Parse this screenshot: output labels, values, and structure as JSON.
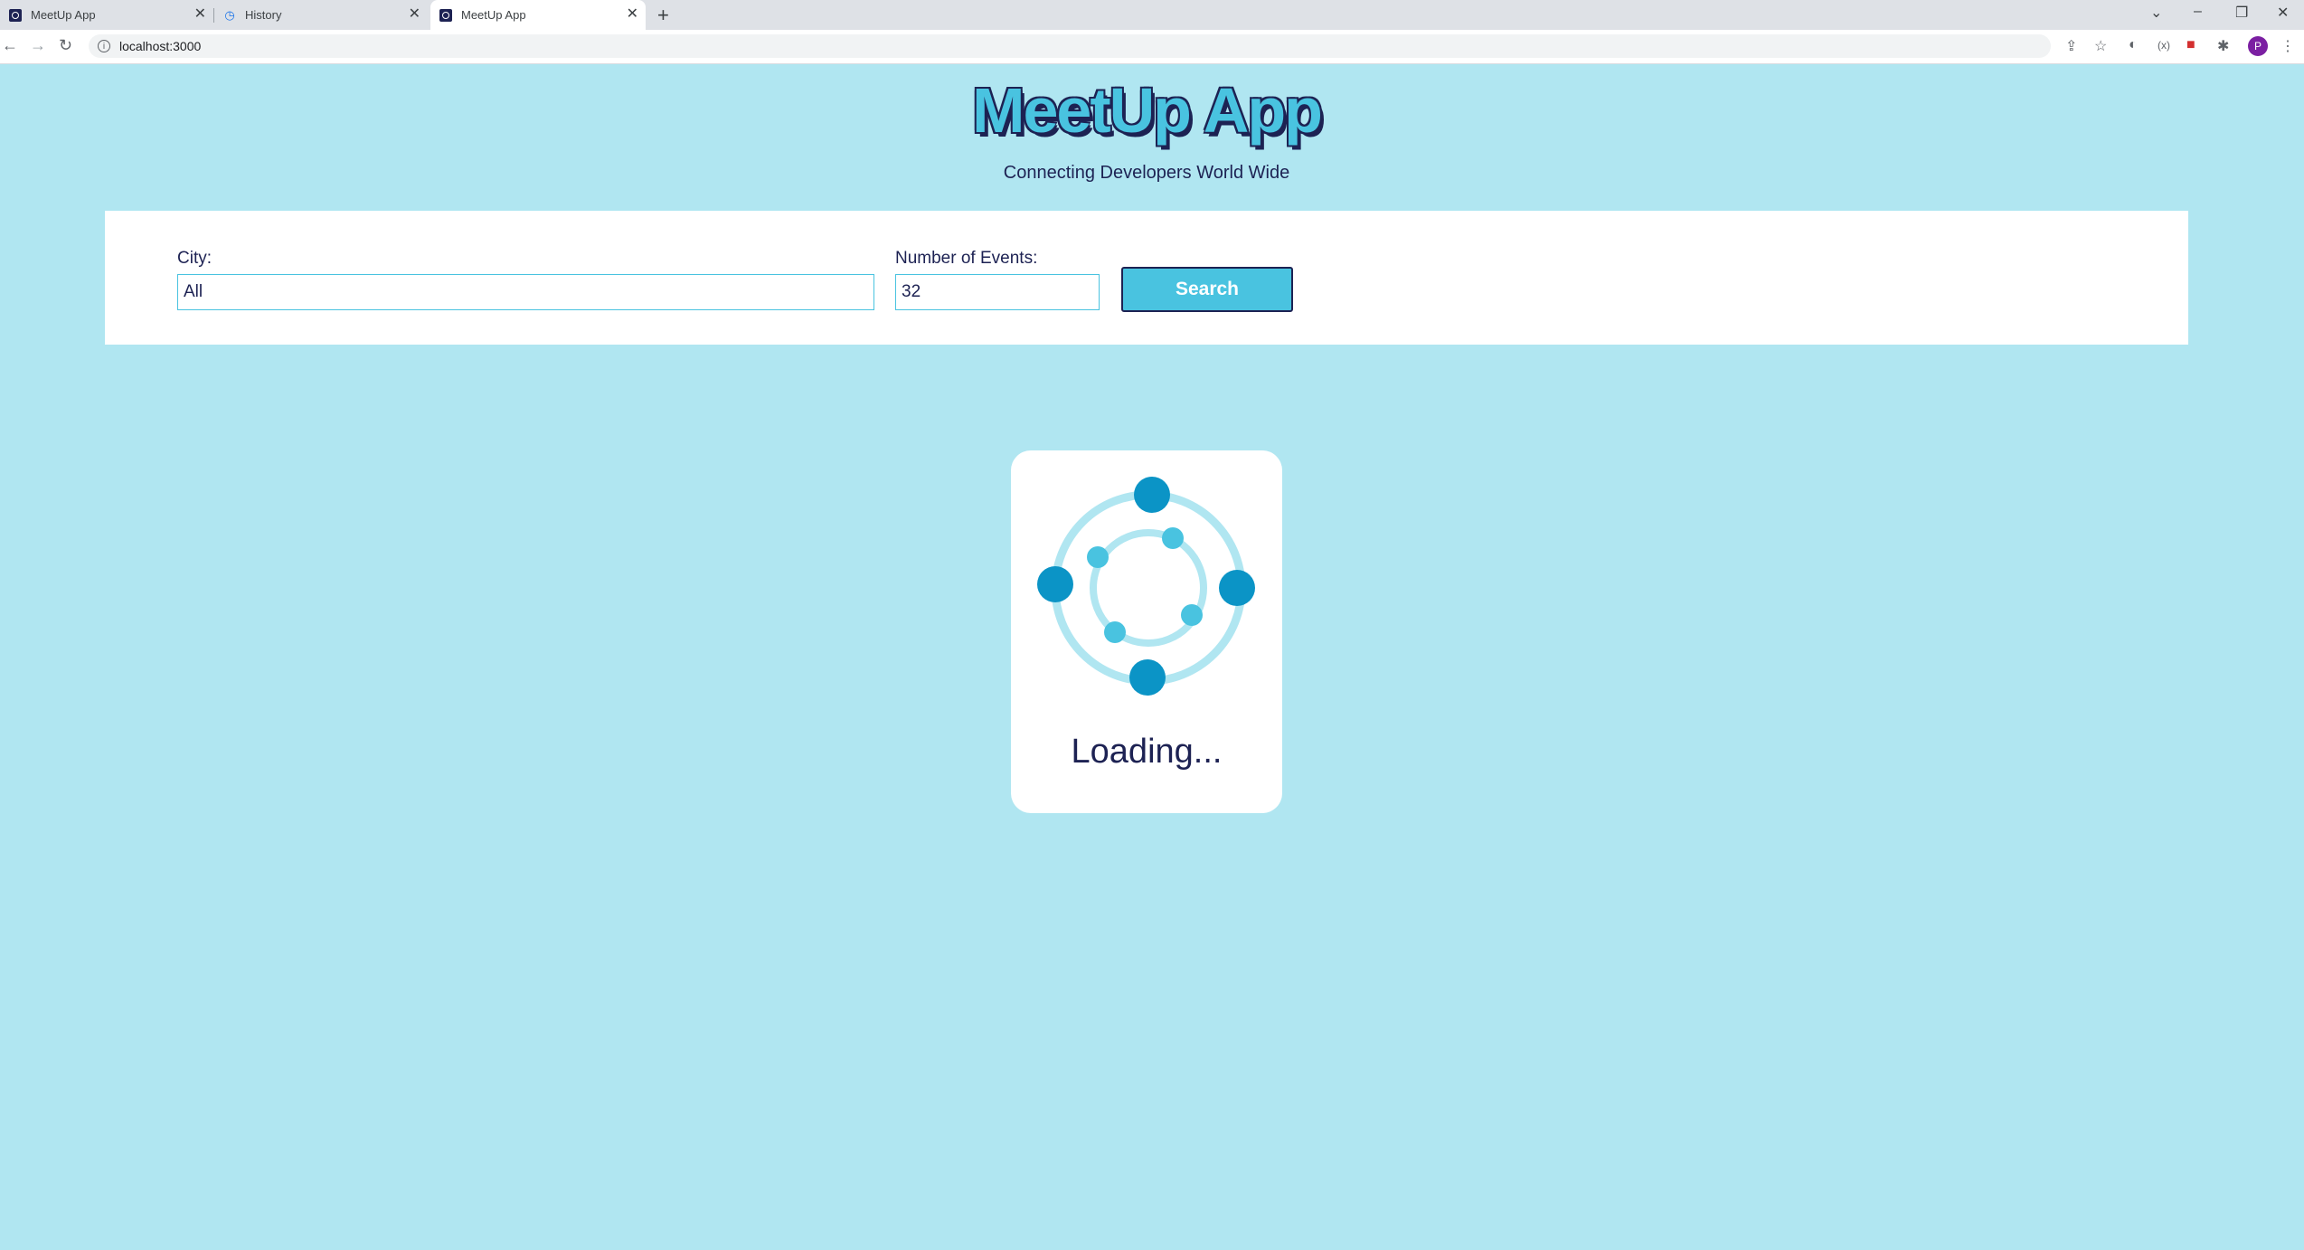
{
  "browser": {
    "tabs": [
      {
        "title": "MeetUp App",
        "active": false
      },
      {
        "title": "History",
        "active": false
      },
      {
        "title": "MeetUp App",
        "active": true
      }
    ],
    "url": "localhost:3000",
    "profile_initial": "P"
  },
  "app": {
    "title": "MeetUp App",
    "subtitle": "Connecting Developers World Wide",
    "search": {
      "city_label": "City:",
      "city_value": "All",
      "events_label": "Number of Events:",
      "events_value": "32",
      "button_label": "Search"
    },
    "loader": {
      "text": "Loading..."
    }
  },
  "colors": {
    "background": "#b0e6f1",
    "accent": "#49c3e0",
    "dark_navy": "#1d2253",
    "loader_dot": "#0b94c6"
  }
}
